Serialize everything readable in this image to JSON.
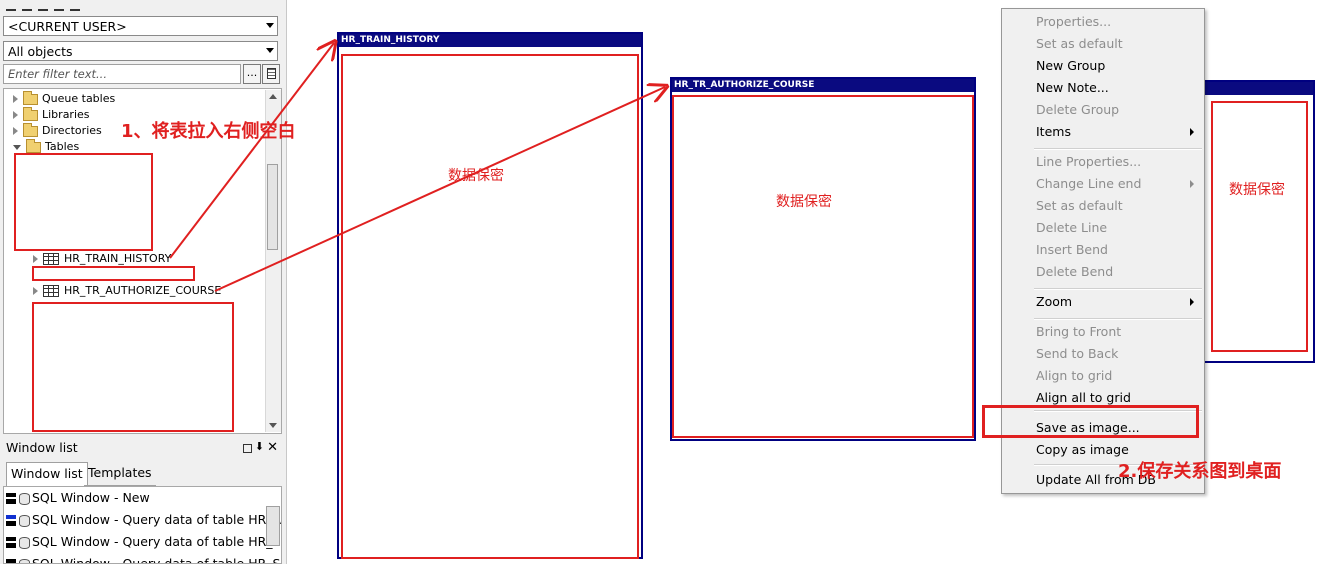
{
  "left_panel": {
    "user_combo": "<CURRENT USER>",
    "objects_combo": "All objects",
    "filter_placeholder": "Enter filter text...",
    "filter_btn": "...",
    "tree_items": [
      "Queue tables",
      "Libraries",
      "Directories",
      "Tables"
    ],
    "table_items": [
      "HR_TRAIN_HISTORY",
      "HR_TR_AUTHORIZE_COURSE"
    ],
    "window_list": {
      "title": "Window list",
      "tabs": [
        "Window list",
        "Templates"
      ],
      "items": [
        "SQL Window - New",
        "SQL Window - Query data of table HR_A",
        "SQL Window - Query data of table HR_S",
        "SQL Window - Query data of table HR_S"
      ]
    }
  },
  "annotations": {
    "step1": "1、将表拉入右侧空白",
    "step2": "2.保存关系图到桌面",
    "secret": "数据保密"
  },
  "diagram": {
    "table1_title": "HR_TRAIN_HISTORY",
    "table2_title": "HR_TR_AUTHORIZE_COURSE"
  },
  "context_menu": {
    "items": [
      {
        "label": "Properties...",
        "enabled": false
      },
      {
        "label": "Set as default",
        "enabled": false
      },
      {
        "label": "New Group",
        "enabled": true
      },
      {
        "label": "New Note...",
        "enabled": true
      },
      {
        "label": "Delete Group",
        "enabled": false
      },
      {
        "label": "Items",
        "enabled": true
      },
      {
        "label": "Line Properties...",
        "enabled": false
      },
      {
        "label": "Change Line end",
        "enabled": false
      },
      {
        "label": "Set as default",
        "enabled": false
      },
      {
        "label": "Delete Line",
        "enabled": false
      },
      {
        "label": "Insert Bend",
        "enabled": false
      },
      {
        "label": "Delete Bend",
        "enabled": false
      },
      {
        "label": "Zoom",
        "enabled": true
      },
      {
        "label": "Bring to Front",
        "enabled": false
      },
      {
        "label": "Send to Back",
        "enabled": false
      },
      {
        "label": "Align to grid",
        "enabled": false
      },
      {
        "label": "Align all to grid",
        "enabled": true
      },
      {
        "label": "Save as image...",
        "enabled": true
      },
      {
        "label": "Copy as image",
        "enabled": true
      },
      {
        "label": "Update All from DB",
        "enabled": true
      }
    ]
  },
  "colors": {
    "annotation_red": "#e02020",
    "title_bar_navy": "#0a0a80",
    "menu_disabled": "#8d8d8d"
  }
}
